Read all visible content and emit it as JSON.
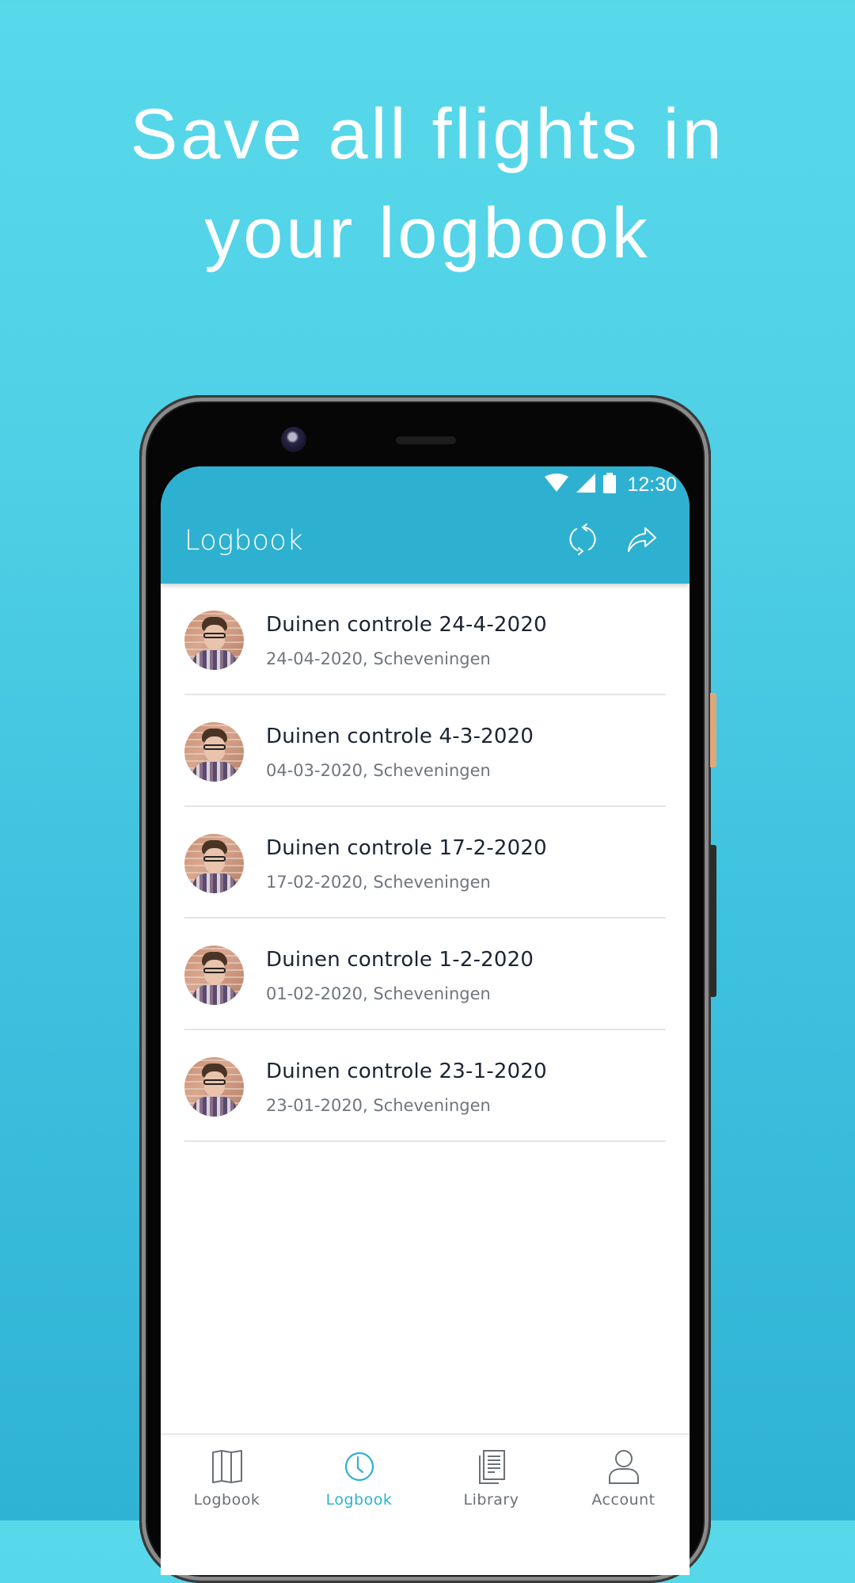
{
  "headline": {
    "line1": "Save all flights in",
    "line2": "your logbook"
  },
  "colors": {
    "accent": "#2eb1d1",
    "background_top": "#58d9ea",
    "background_bottom": "#2fb3d5",
    "title_text": "#1b2434",
    "subtitle_text": "#6f767e",
    "nav_inactive": "#6b7076"
  },
  "status_bar": {
    "time": "12:30",
    "icons": [
      "wifi-icon",
      "cell-signal-icon",
      "battery-icon"
    ]
  },
  "appbar": {
    "title": "Logbook",
    "actions": [
      {
        "name": "refresh",
        "icon": "refresh-icon"
      },
      {
        "name": "share",
        "icon": "share-icon"
      }
    ]
  },
  "flights": [
    {
      "title": "Duinen controle 24-4-2020",
      "subtitle": "24-04-2020, Scheveningen"
    },
    {
      "title": "Duinen controle 4-3-2020",
      "subtitle": "04-03-2020, Scheveningen"
    },
    {
      "title": "Duinen controle 17-2-2020",
      "subtitle": "17-02-2020, Scheveningen"
    },
    {
      "title": "Duinen controle 1-2-2020",
      "subtitle": "01-02-2020, Scheveningen"
    },
    {
      "title": "Duinen controle 23-1-2020",
      "subtitle": "23-01-2020, Scheveningen"
    }
  ],
  "bottom_nav": [
    {
      "label": "Logbook",
      "icon": "map-icon",
      "active": false
    },
    {
      "label": "Logbook",
      "icon": "clock-icon",
      "active": true
    },
    {
      "label": "Library",
      "icon": "library-icon",
      "active": false
    },
    {
      "label": "Account",
      "icon": "account-icon",
      "active": false
    }
  ]
}
